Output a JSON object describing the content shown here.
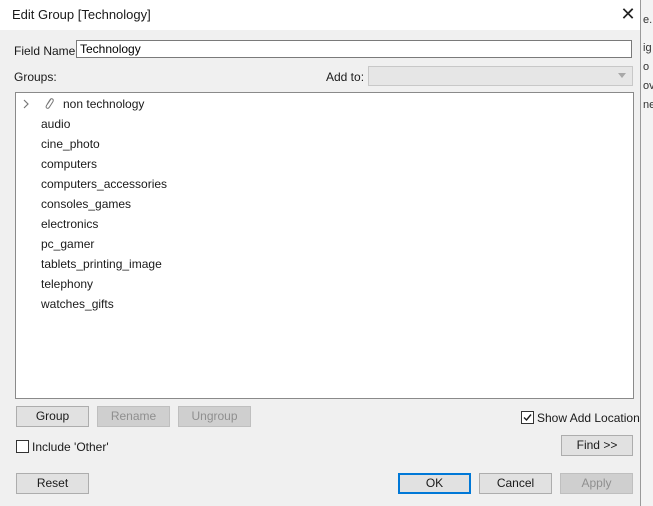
{
  "dialog": {
    "title": "Edit Group [Technology]",
    "close_icon": "close-icon"
  },
  "field_name": {
    "label": "Field Name:",
    "value": "Technology"
  },
  "groups": {
    "label": "Groups:",
    "add_to_label": "Add to:",
    "add_to_value": "",
    "group_item": {
      "label": "non technology",
      "icon": "paperclip-icon",
      "expand_icon": "chevron-right-icon"
    },
    "items": [
      "audio",
      "cine_photo",
      "computers",
      "computers_accessories",
      "consoles_games",
      "electronics",
      "pc_gamer",
      "tablets_printing_image",
      "telephony",
      "watches_gifts"
    ]
  },
  "buttons": {
    "group": "Group",
    "rename": "Rename",
    "ungroup": "Ungroup",
    "find": "Find >>",
    "reset": "Reset",
    "ok": "OK",
    "cancel": "Cancel",
    "apply": "Apply"
  },
  "options": {
    "show_add_location": "Show Add Location",
    "show_add_location_checked": true,
    "include_other": "Include 'Other'",
    "include_other_checked": false
  },
  "background_window": {
    "fragments": [
      "e.",
      "ig",
      "o",
      "ov",
      "ne"
    ]
  }
}
